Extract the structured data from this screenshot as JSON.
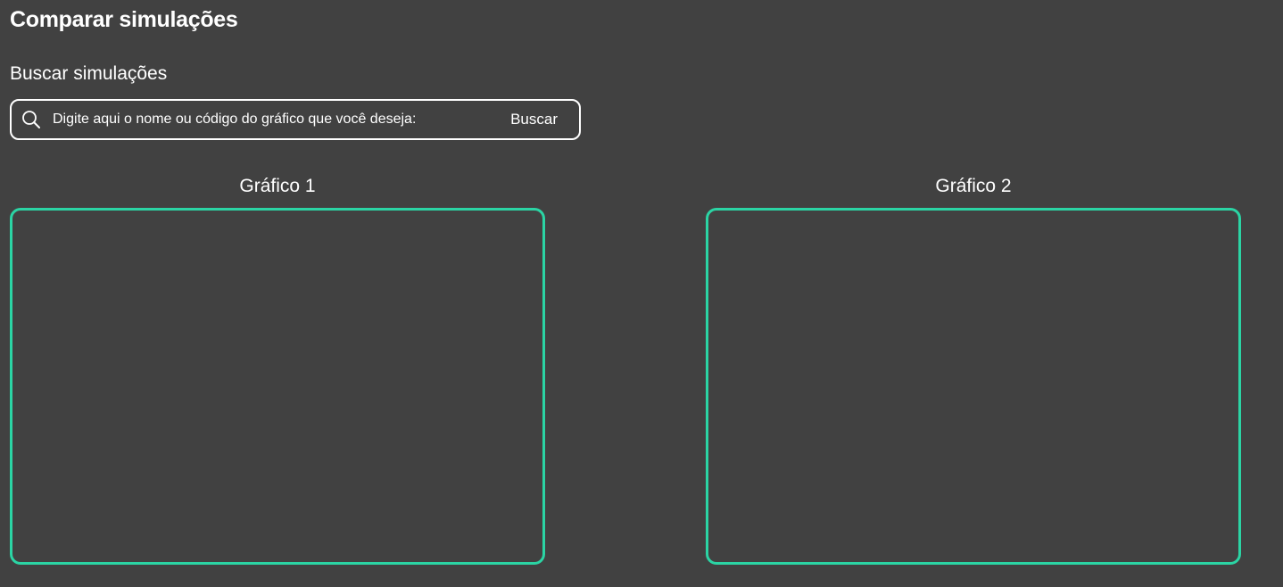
{
  "header": {
    "title": "Comparar simulações"
  },
  "search": {
    "heading": "Buscar simulações",
    "placeholder": "Digite aqui o nome ou código do gráfico que você deseja:",
    "value": "",
    "button_label": "Buscar",
    "icon": "search-icon"
  },
  "charts": [
    {
      "label": "Gráfico 1"
    },
    {
      "label": "Gráfico 2"
    }
  ],
  "colors": {
    "background": "#414141",
    "accent": "#2bd4a4",
    "text": "#ffffff"
  }
}
